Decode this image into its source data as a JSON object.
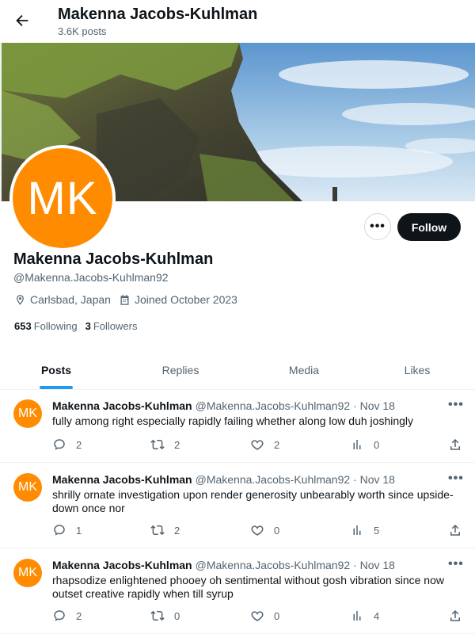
{
  "header": {
    "name": "Makenna Jacobs-Kuhlman",
    "posts_count": "3.6K posts",
    "back_icon": "arrow-left-icon"
  },
  "profile": {
    "avatar_initials": "MK",
    "avatar_color": "#ff8c00",
    "name": "Makenna Jacobs-Kuhlman",
    "handle": "@Makenna.Jacobs-Kuhlman92",
    "location": "Carlsbad, Japan",
    "joined": "Joined October 2023",
    "following_count": "653",
    "following_label": "Following",
    "followers_count": "3",
    "followers_label": "Followers",
    "more_label": "•••",
    "follow_label": "Follow"
  },
  "tabs": [
    {
      "label": "Posts",
      "active": true
    },
    {
      "label": "Replies",
      "active": false
    },
    {
      "label": "Media",
      "active": false
    },
    {
      "label": "Likes",
      "active": false
    }
  ],
  "posts": [
    {
      "initials": "MK",
      "name": "Makenna Jacobs-Kuhlman",
      "meta": "@Makenna.Jacobs-Kuhlman92 · Nov 18",
      "text": "fully among right especially rapidly failing whether along low duh joshingly",
      "replies": "2",
      "reposts": "2",
      "likes": "2",
      "views": "0"
    },
    {
      "initials": "MK",
      "name": "Makenna Jacobs-Kuhlman",
      "meta": "@Makenna.Jacobs-Kuhlman92 · Nov 18",
      "text": "shrilly ornate investigation upon render generosity unbearably worth since upside-down once nor",
      "replies": "1",
      "reposts": "2",
      "likes": "0",
      "views": "5"
    },
    {
      "initials": "MK",
      "name": "Makenna Jacobs-Kuhlman",
      "meta": "@Makenna.Jacobs-Kuhlman92 · Nov 18",
      "text": "rhapsodize enlightened phooey oh sentimental without gosh vibration since now outset creative rapidly when till syrup",
      "replies": "2",
      "reposts": "0",
      "likes": "0",
      "views": "4"
    }
  ],
  "post_more_label": "•••",
  "colors": {
    "accent": "#1d9bf0",
    "text": "#0f1419",
    "muted": "#536471"
  }
}
